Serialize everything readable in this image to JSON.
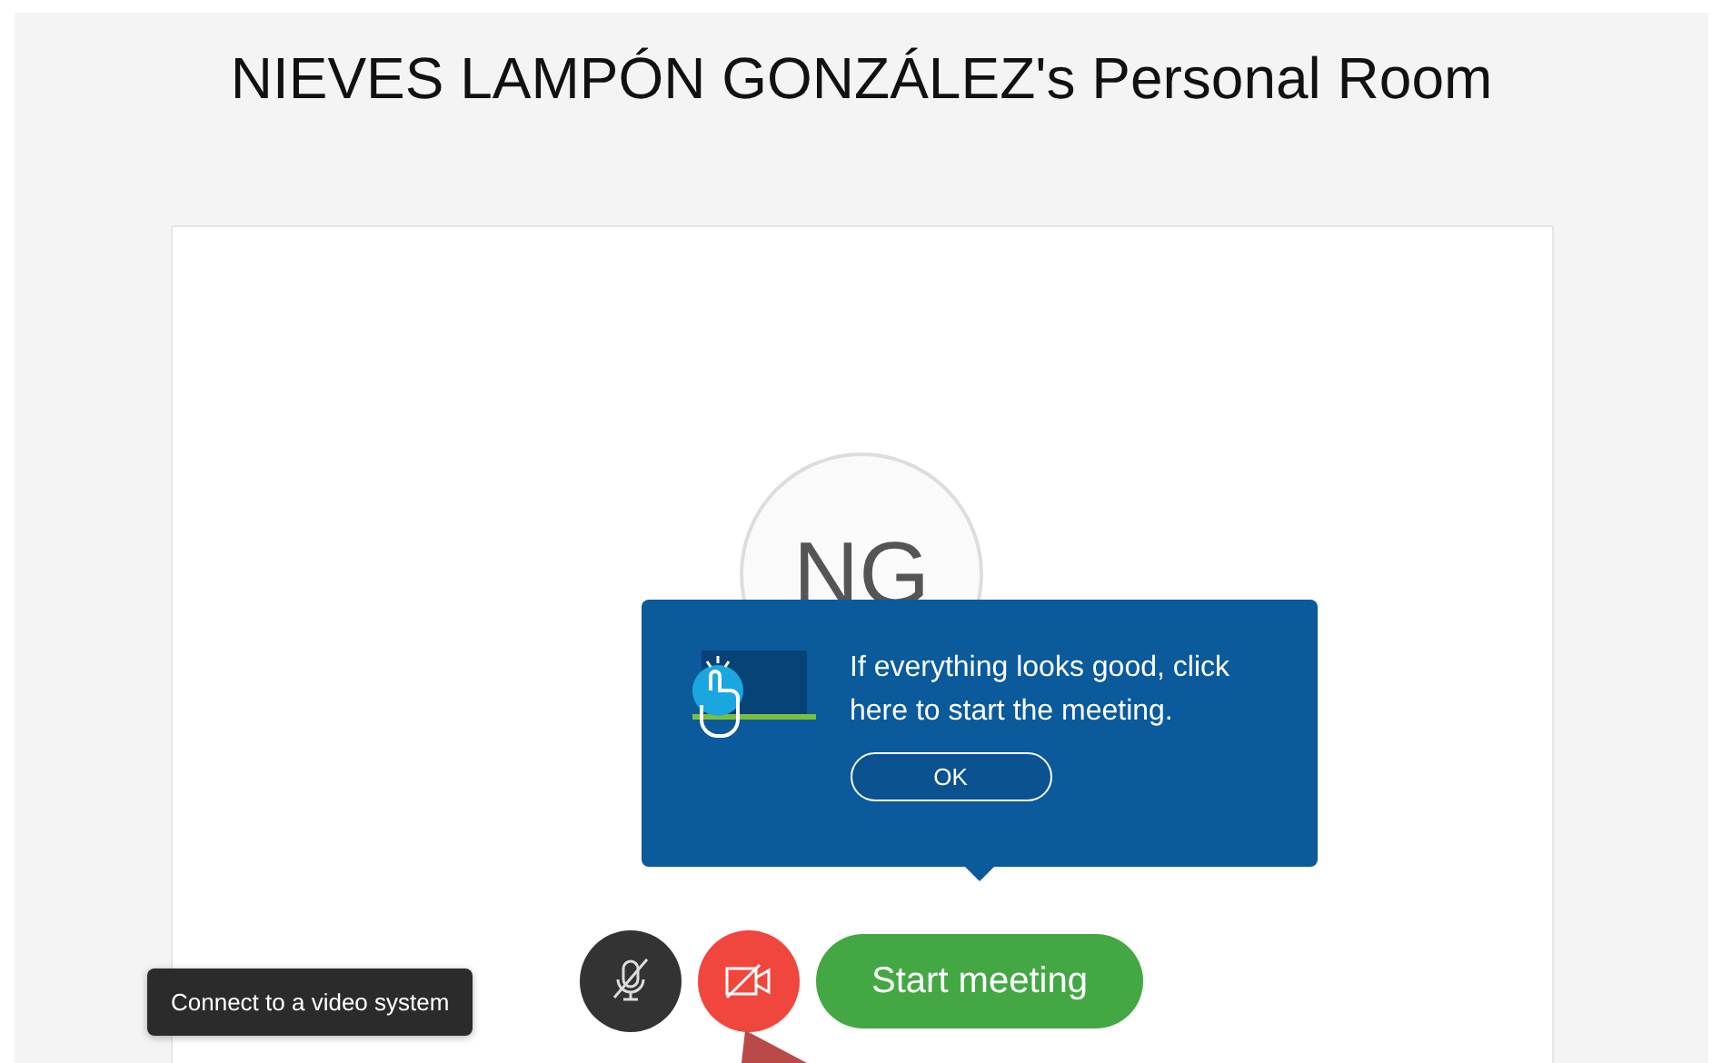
{
  "page_title": "NIEVES LAMPÓN GONZÁLEZ's Personal Room",
  "avatar": {
    "initials": "NG"
  },
  "popover": {
    "message": "If everything looks good, click here to start the meeting.",
    "button": "OK"
  },
  "controls": {
    "mic_muted": true,
    "video_off": true,
    "start_button": "Start meeting"
  },
  "tooltip": "Connect to a video system"
}
